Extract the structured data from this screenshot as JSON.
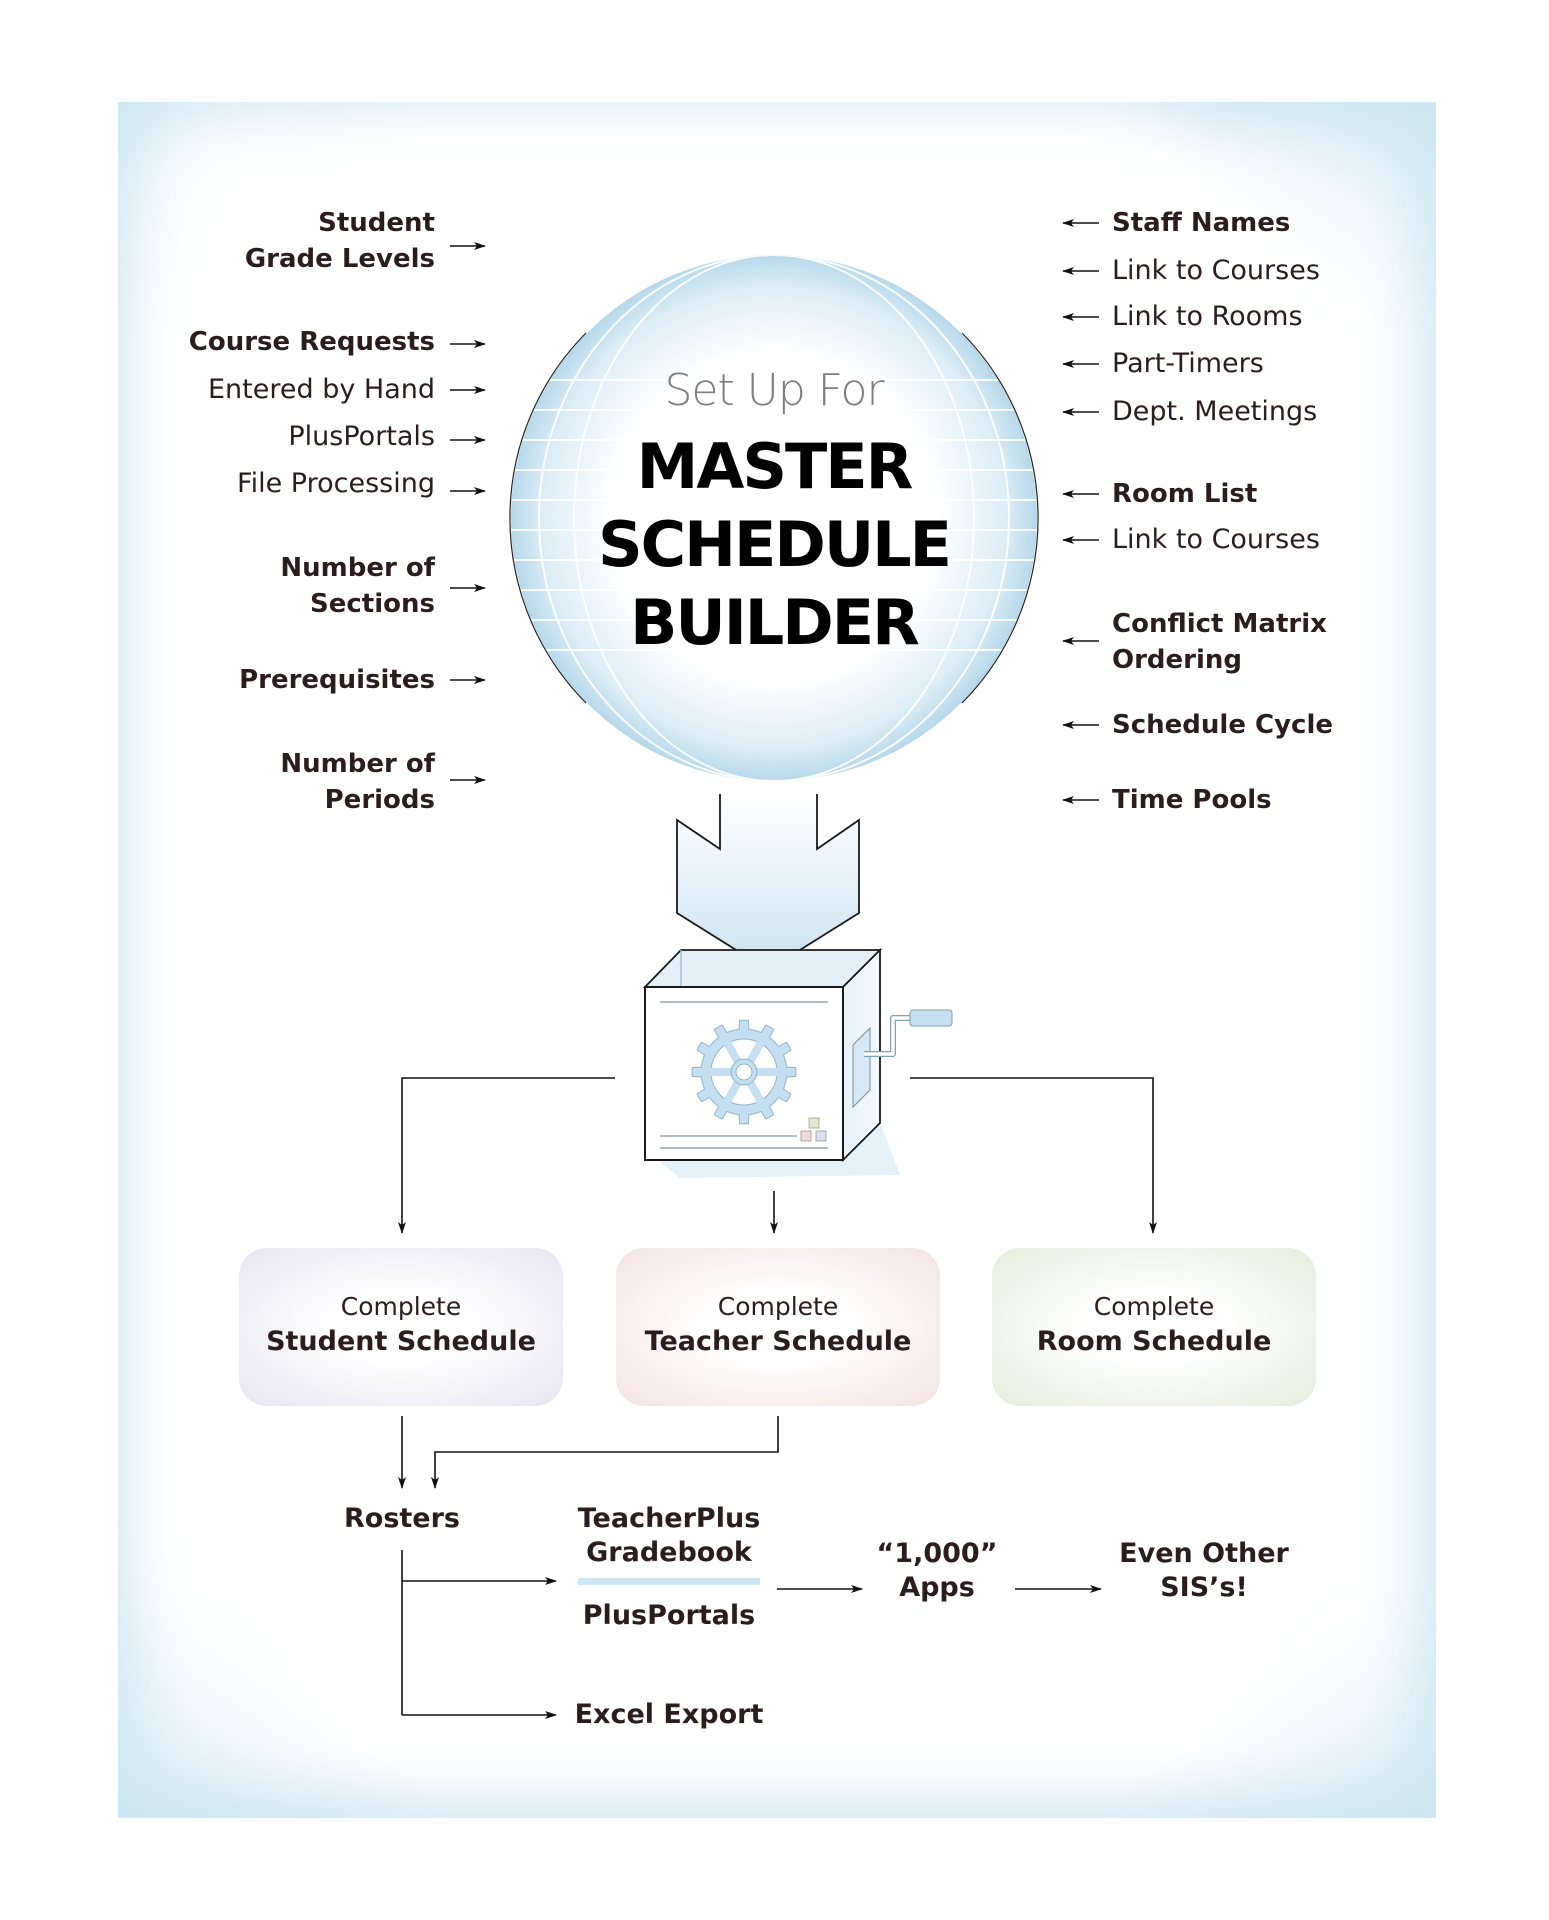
{
  "title": {
    "subtitle": "Set Up For",
    "line1": "MASTER",
    "line2": "SCHEDULE",
    "line3": "BUILDER"
  },
  "inputs_left": [
    {
      "lines": [
        "Student",
        "Grade Levels"
      ],
      "bold": true
    },
    {
      "lines": [
        "Course Requests"
      ],
      "bold": true
    },
    {
      "lines": [
        "Entered by Hand"
      ],
      "bold": false
    },
    {
      "lines": [
        "PlusPortals"
      ],
      "bold": false
    },
    {
      "lines": [
        "File Processing"
      ],
      "bold": false
    },
    {
      "lines": [
        "Number of",
        "Sections"
      ],
      "bold": true
    },
    {
      "lines": [
        "Prerequisites"
      ],
      "bold": true
    },
    {
      "lines": [
        "Number of",
        "Periods"
      ],
      "bold": true
    }
  ],
  "inputs_right": [
    {
      "lines": [
        "Staff Names"
      ],
      "bold": true
    },
    {
      "lines": [
        "Link to Courses"
      ],
      "bold": false
    },
    {
      "lines": [
        "Link to Rooms"
      ],
      "bold": false
    },
    {
      "lines": [
        "Part-Timers"
      ],
      "bold": false
    },
    {
      "lines": [
        "Dept. Meetings"
      ],
      "bold": false
    },
    {
      "lines": [
        "Room List"
      ],
      "bold": true
    },
    {
      "lines": [
        "Link to Courses"
      ],
      "bold": false
    },
    {
      "lines": [
        "Conflict Matrix",
        "Ordering"
      ],
      "bold": true
    },
    {
      "lines": [
        "Schedule Cycle"
      ],
      "bold": true
    },
    {
      "lines": [
        "Time Pools"
      ],
      "bold": true
    }
  ],
  "schedules": [
    {
      "prefix": "Complete",
      "name": "Student Schedule",
      "tint": "#e6e4ef"
    },
    {
      "prefix": "Complete",
      "name": "Teacher Schedule",
      "tint": "#f3e2e2"
    },
    {
      "prefix": "Complete",
      "name": "Room Schedule",
      "tint": "#e4ecdb"
    }
  ],
  "outputs": {
    "rosters": "Rosters",
    "gradebook_line1": "TeacherPlus",
    "gradebook_line2": "Gradebook",
    "portals": "PlusPortals",
    "excel": "Excel Export",
    "apps_line1": "“1,000”",
    "apps_line2": "Apps",
    "sis_line1": "Even Other",
    "sis_line2": "SIS’s!"
  },
  "colors": {
    "text": "#2b1d1e",
    "accent_blue": "#c5e3f1",
    "gear": "#c5dff0",
    "gear_outline": "#8fb3c9"
  }
}
